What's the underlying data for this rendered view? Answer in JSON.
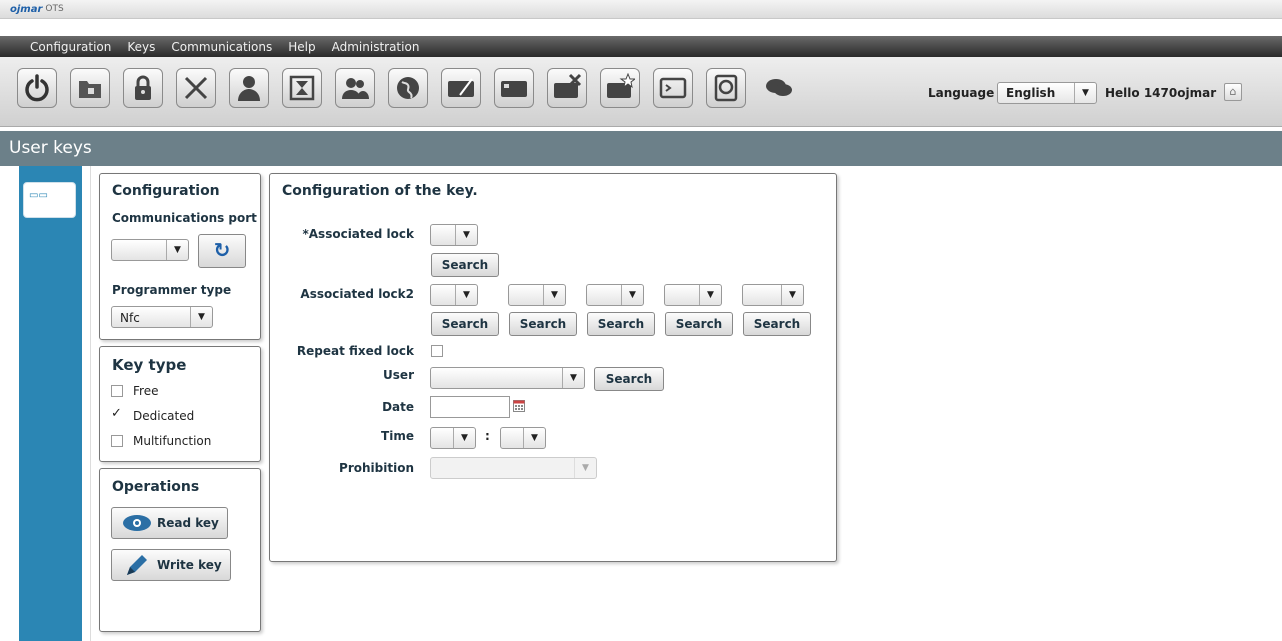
{
  "app": {
    "brand": "ojmar",
    "brand_sub": "OTS"
  },
  "menu": [
    "Configuration",
    "Keys",
    "Communications",
    "Help",
    "Administration"
  ],
  "toolbar_icons": [
    "power-icon",
    "folder-icon",
    "lock-icon",
    "tools-icon",
    "user-icon",
    "hourglass-icon",
    "users-icon",
    "globe-icon",
    "key-edit-icon",
    "key-card-icon",
    "key-delete-icon",
    "key-new-icon",
    "terminal-icon",
    "harddisk-icon",
    "chat-icon"
  ],
  "header": {
    "language_label": "Language",
    "language_value": "English",
    "greeting": "Hello 1470ojmar"
  },
  "page_title": "User keys",
  "config_panel": {
    "title": "Configuration",
    "port_label": "Communications port",
    "port_value": "",
    "programmer_label": "Programmer type",
    "programmer_value": "Nfc"
  },
  "key_type": {
    "title": "Key type",
    "options": [
      {
        "label": "Free",
        "checked": false
      },
      {
        "label": "Dedicated",
        "checked": true
      },
      {
        "label": "Multifunction",
        "checked": false
      }
    ]
  },
  "operations": {
    "title": "Operations",
    "read": "Read key",
    "write": "Write key"
  },
  "key_config": {
    "title": "Configuration of the key.",
    "assoc_lock_label": "*Associated lock",
    "assoc_lock2_label": "Associated lock2",
    "repeat_label": "Repeat fixed lock",
    "user_label": "User",
    "date_label": "Date",
    "time_label": "Time",
    "time_sep": ":",
    "prohibition_label": "Prohibition",
    "search_label": "Search"
  }
}
